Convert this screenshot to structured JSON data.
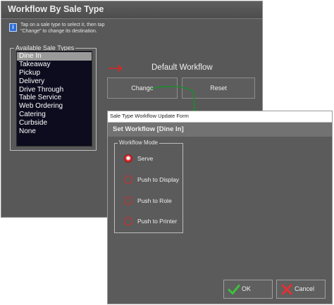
{
  "back_window": {
    "title": "Workflow By Sale Type",
    "info_text": "Tap on a sale type to select it, then tap \"Change\" to change its destination.",
    "available_sale_types_label": "Available Sale Types",
    "sale_types": [
      "Dine In",
      "Takeaway",
      "Pickup",
      "Delivery",
      "Drive Through",
      "Table Service",
      "Web Ordering",
      "Catering",
      "Curbside",
      "None"
    ],
    "selected_sale_type": "Dine In",
    "default_workflow_label": "Default Workflow",
    "change_label": "Change",
    "reset_label": "Reset"
  },
  "dialog": {
    "title": "Sale Type Workflow Update Form",
    "subheader": "Set Workflow  [Dine In]",
    "workflow_mode_label": "Workflow Mode",
    "modes": [
      {
        "label": "Serve",
        "checked": true
      },
      {
        "label": "Push to Display",
        "checked": false
      },
      {
        "label": "Push to Role",
        "checked": false
      },
      {
        "label": "Push to Printer",
        "checked": false
      }
    ],
    "ok_label": "OK",
    "cancel_label": "Cancel"
  },
  "colors": {
    "accent_red": "#e02424",
    "connector_green": "#1f8a2e",
    "list_bg": "#0c0c1e",
    "selection": "#9a9a9a"
  },
  "icons": {
    "info": "info-icon",
    "arrow": "arrow-right-icon",
    "ok": "check-icon",
    "cancel": "x-icon"
  }
}
